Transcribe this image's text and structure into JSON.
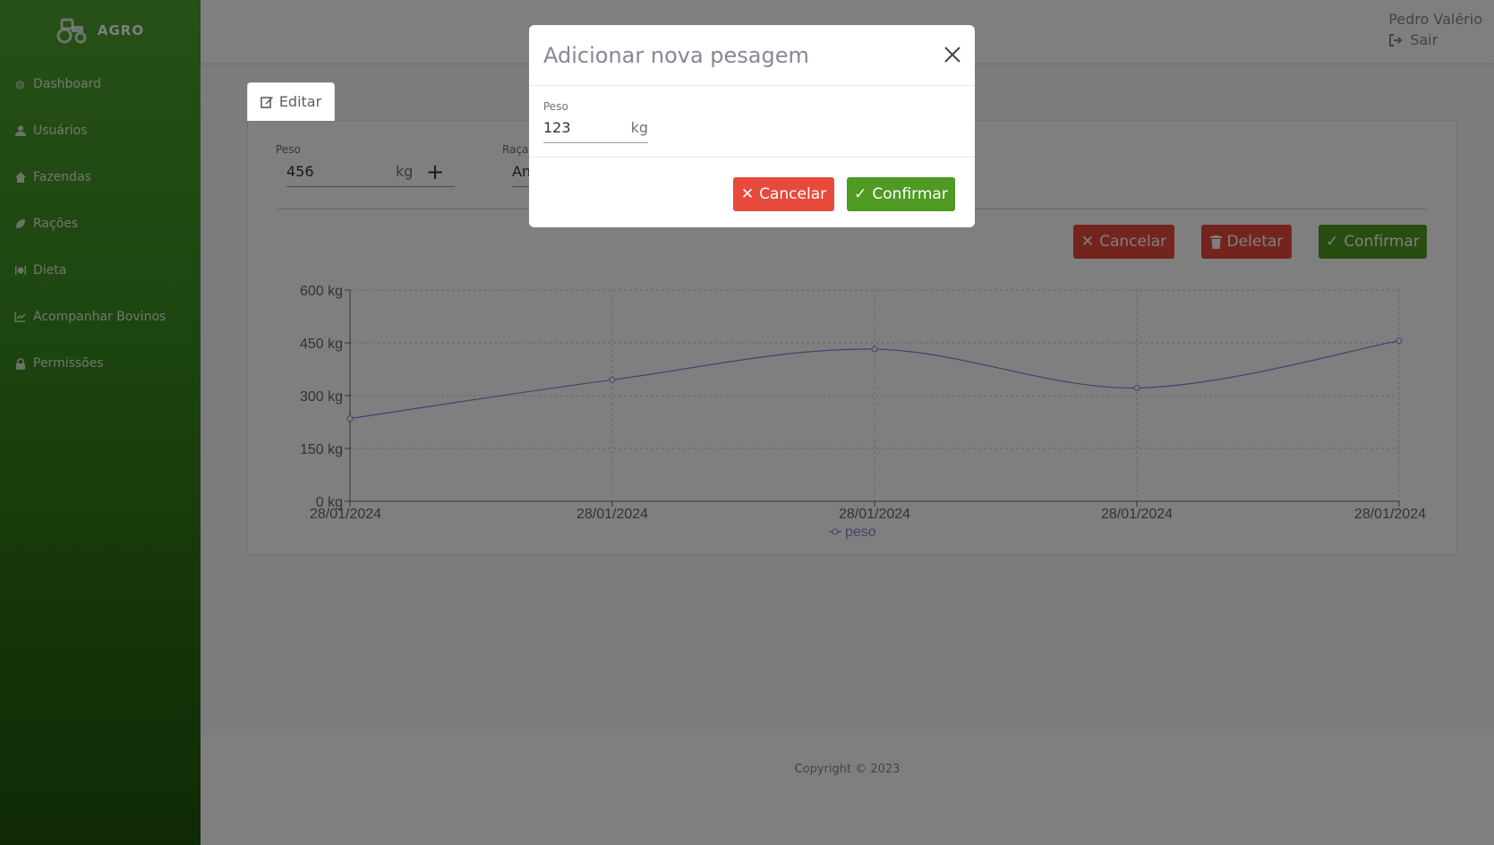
{
  "brand": {
    "name": "AGRO",
    "icon": "tractor-icon"
  },
  "sidebar": {
    "items": [
      {
        "label": "Dashboard",
        "icon": "palette-icon"
      },
      {
        "label": "Usuários",
        "icon": "user-icon"
      },
      {
        "label": "Fazendas",
        "icon": "home-icon"
      },
      {
        "label": "Rações",
        "icon": "leaf-icon"
      },
      {
        "label": "Dieta",
        "icon": "utensils-icon"
      },
      {
        "label": "Acompanhar Bovinos",
        "icon": "chart-line-icon"
      },
      {
        "label": "Permissões",
        "icon": "lock-icon"
      }
    ]
  },
  "topbar": {
    "user_name": "Pedro Valério",
    "logout_label": "Sair"
  },
  "tab": {
    "label": "Editar"
  },
  "form": {
    "peso_label": "Peso",
    "peso_value": "456",
    "peso_unit": "kg",
    "raca_label": "Raça",
    "raca_value": "An"
  },
  "actions": {
    "cancel": "Cancelar",
    "delete": "Deletar",
    "confirm": "Confirmar"
  },
  "chart_data": {
    "type": "line",
    "x": [
      "28/01/2024",
      "28/01/2024",
      "28/01/2024",
      "28/01/2024",
      "28/01/2024"
    ],
    "series": [
      {
        "name": "peso",
        "values": [
          235,
          345,
          432,
          322,
          456
        ]
      }
    ],
    "yticks": [
      "0 kg",
      "150 kg",
      "300 kg",
      "450 kg",
      "600 kg"
    ],
    "ylim": [
      0,
      600
    ],
    "grid": true,
    "legend": "bottom",
    "color": "#8884d8"
  },
  "footer": {
    "copyright": "Copyright © 2023"
  },
  "modal": {
    "title": "Adicionar nova pesagem",
    "peso_label": "Peso",
    "peso_value": "123",
    "peso_unit": "kg",
    "cancel": "Cancelar",
    "confirm": "Confirmar"
  },
  "colors": {
    "brand_green": "#4e9a22",
    "danger": "#e74a3b",
    "line": "#8884d8"
  }
}
